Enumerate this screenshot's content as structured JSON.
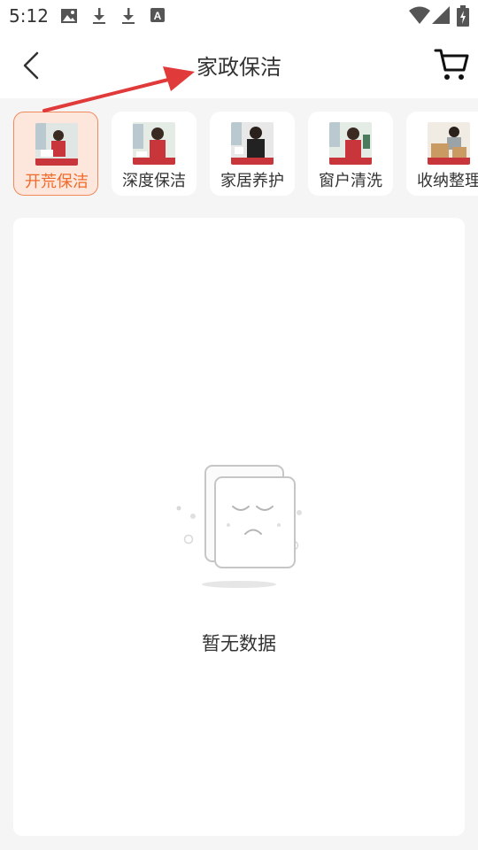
{
  "status_bar": {
    "time": "5:12",
    "left_icons": [
      "image-icon",
      "download-icon",
      "download-icon",
      "a-icon"
    ],
    "right_icons": [
      "wifi-icon",
      "signal-icon",
      "battery-icon"
    ]
  },
  "header": {
    "title": "家政保洁",
    "back_icon": "back-chevron-icon",
    "cart_icon": "cart-icon"
  },
  "categories": [
    {
      "label": "开荒保洁",
      "active": true
    },
    {
      "label": "深度保洁",
      "active": false
    },
    {
      "label": "家居养护",
      "active": false
    },
    {
      "label": "窗户清洗",
      "active": false
    },
    {
      "label": "收纳整理",
      "active": false
    }
  ],
  "empty_state": {
    "message": "暂无数据",
    "icon": "empty-box-sad-icon"
  },
  "colors": {
    "accent": "#f06a2a",
    "active_bg": "#fde7dd",
    "annotation": "#e03a3a"
  }
}
